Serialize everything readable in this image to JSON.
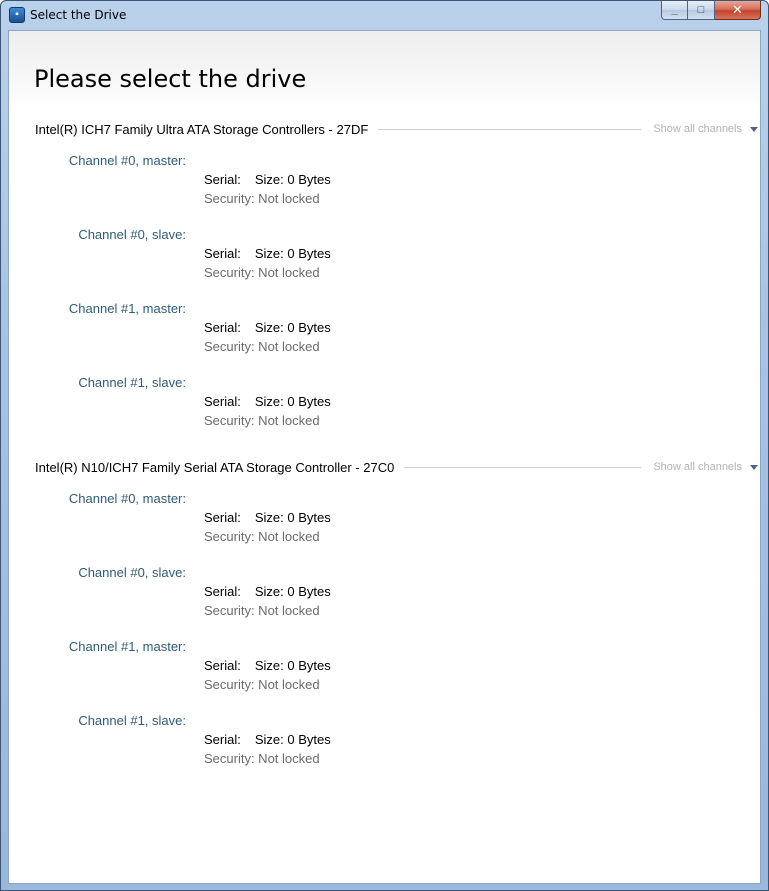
{
  "window": {
    "title": "Select the Drive",
    "icon": "app-drive-icon",
    "controls": {
      "minimize": "_",
      "maximize": "□",
      "close": "✕"
    }
  },
  "page": {
    "title": "Please select the drive"
  },
  "controllers": [
    {
      "name": "Intel(R) ICH7 Family Ultra ATA Storage Controllers - 27DF",
      "show_all": "Show all channels",
      "channels": [
        {
          "label": "Channel #0, master:",
          "serial": "Serial:",
          "size": "Size: 0 Bytes",
          "security": "Security: Not locked"
        },
        {
          "label": "Channel #0, slave:",
          "serial": "Serial:",
          "size": "Size: 0 Bytes",
          "security": "Security: Not locked"
        },
        {
          "label": "Channel #1, master:",
          "serial": "Serial:",
          "size": "Size: 0 Bytes",
          "security": "Security: Not locked"
        },
        {
          "label": "Channel #1, slave:",
          "serial": "Serial:",
          "size": "Size: 0 Bytes",
          "security": "Security: Not locked"
        }
      ]
    },
    {
      "name": "Intel(R) N10/ICH7 Family Serial ATA Storage Controller - 27C0",
      "show_all": "Show all channels",
      "channels": [
        {
          "label": "Channel #0, master:",
          "serial": "Serial:",
          "size": "Size: 0 Bytes",
          "security": "Security: Not locked"
        },
        {
          "label": "Channel #0, slave:",
          "serial": "Serial:",
          "size": "Size: 0 Bytes",
          "security": "Security: Not locked"
        },
        {
          "label": "Channel #1, master:",
          "serial": "Serial:",
          "size": "Size: 0 Bytes",
          "security": "Security: Not locked"
        },
        {
          "label": "Channel #1, slave:",
          "serial": "Serial:",
          "size": "Size: 0 Bytes",
          "security": "Security: Not locked"
        }
      ]
    }
  ],
  "colors": {
    "channel_label": "#2e5c78",
    "muted_text": "#6b6b6b",
    "show_all_text": "#b3b3b3"
  }
}
